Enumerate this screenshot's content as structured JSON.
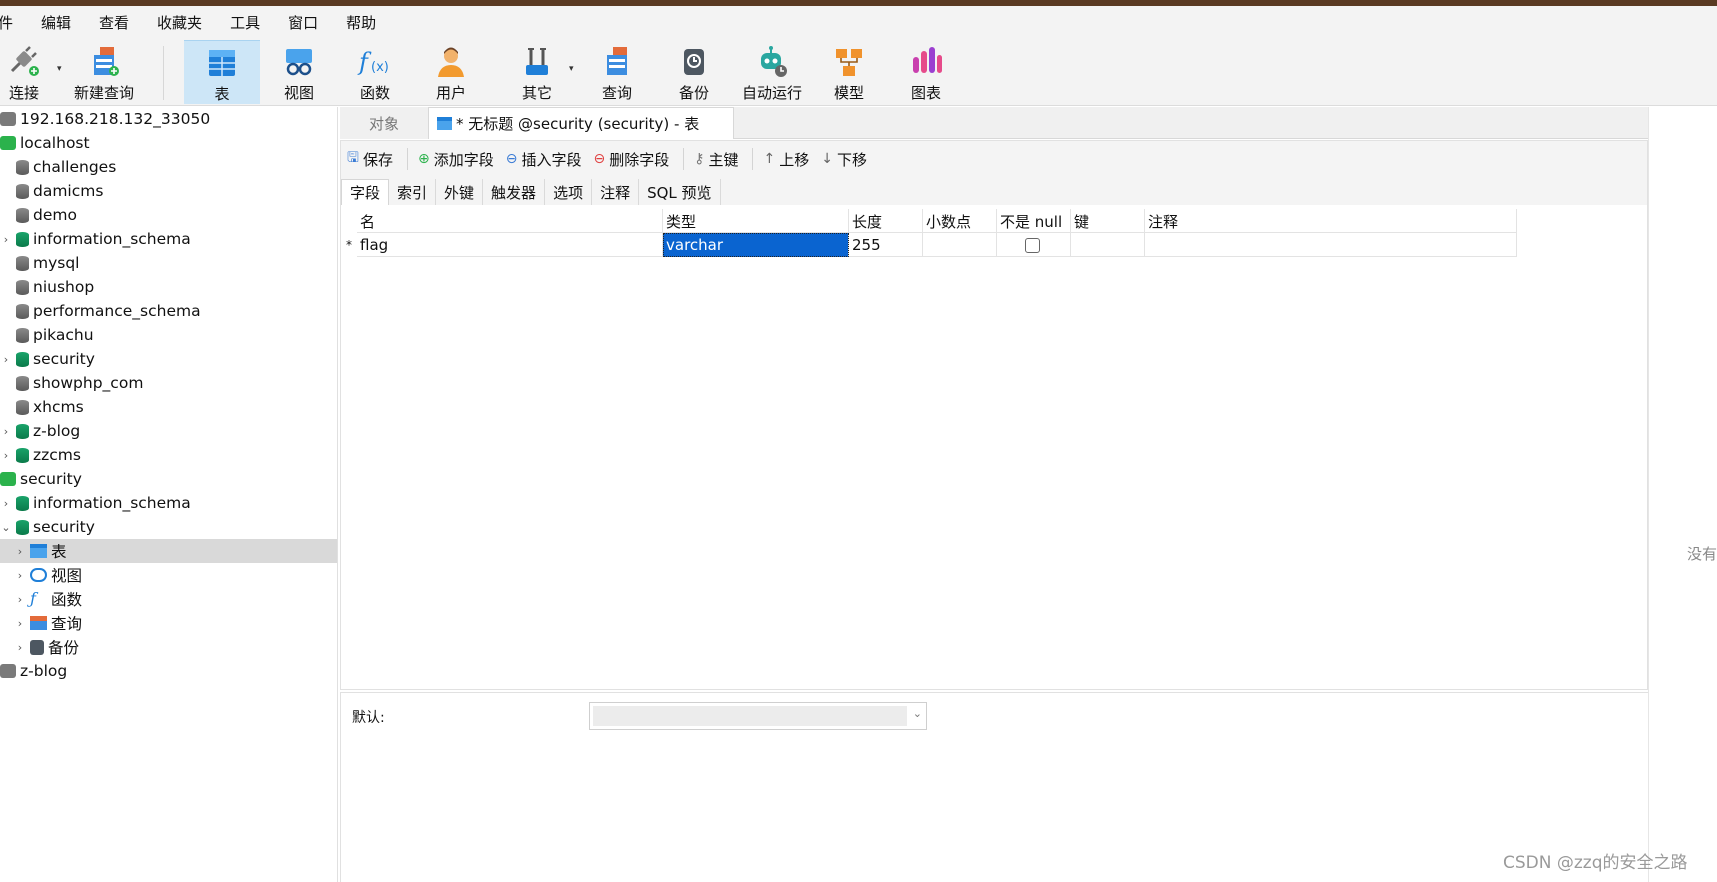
{
  "menu": [
    "件",
    "编辑",
    "查看",
    "收藏夹",
    "工具",
    "窗口",
    "帮助"
  ],
  "toolbar": {
    "connect": "连接",
    "new_query": "新建查询",
    "table": "表",
    "view": "视图",
    "function": "函数",
    "user": "用户",
    "other": "其它",
    "query": "查询",
    "backup": "备份",
    "automation": "自动运行",
    "model": "模型",
    "chart": "图表"
  },
  "tree": {
    "conn1": "192.168.218.132_33050",
    "conn2": "localhost",
    "dbs": [
      "challenges",
      "damicms",
      "demo",
      "information_schema",
      "mysql",
      "niushop",
      "performance_schema",
      "pikachu",
      "security",
      "showphp_com",
      "xhcms",
      "z-blog",
      "zzcms"
    ],
    "conn3": "security",
    "sec_db1": "information_schema",
    "sec_db2": "security",
    "children": [
      "表",
      "视图",
      "函数",
      "查询",
      "备份"
    ],
    "conn4": "z-blog"
  },
  "tabs": {
    "objects": "对象",
    "current": "* 无标题 @security (security) - 表"
  },
  "editor_toolbar": {
    "save": "保存",
    "add_field": "添加字段",
    "insert_field": "插入字段",
    "delete_field": "删除字段",
    "primary_key": "主键",
    "move_up": "上移",
    "move_down": "下移"
  },
  "subtabs": [
    "字段",
    "索引",
    "外键",
    "触发器",
    "选项",
    "注释",
    "SQL 预览"
  ],
  "grid": {
    "headers": [
      "名",
      "类型",
      "长度",
      "小数点",
      "不是 null",
      "键",
      "注释"
    ],
    "row": {
      "marker": "*",
      "name": "flag",
      "type": "varchar",
      "length": "255",
      "decimals": "",
      "not_null": false,
      "key": "",
      "comment": ""
    }
  },
  "props": {
    "default_label": "默认:"
  },
  "right_panel": {
    "text": "没有"
  },
  "watermark": "CSDN @zzq的安全之路"
}
